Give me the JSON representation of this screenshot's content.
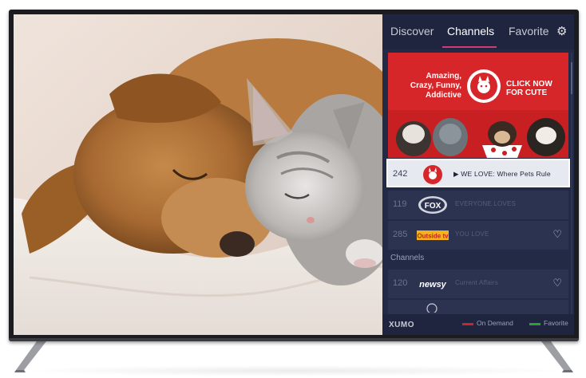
{
  "tabs": [
    {
      "label": "Discover"
    },
    {
      "label": "Channels"
    },
    {
      "label": "Favorite"
    }
  ],
  "icons": {
    "settings": "gear-icon",
    "heart": "heart-icon",
    "play": "play-icon"
  },
  "banner": {
    "tagline": "Amazing, Crazy, Funny, Addictive",
    "logo_text": "THE PET COLLECTIVE",
    "cta": "CLICK NOW FOR CUTE"
  },
  "channels_top": [
    {
      "number": "242",
      "logo": "THE PET COLLECTIVE",
      "title": "▶ WE LOVE: Where Pets Rule",
      "selected": true
    },
    {
      "number": "119",
      "logo": "FOX",
      "title": "EVERYONE LOVES",
      "selected": false
    },
    {
      "number": "285",
      "logo": "Outside tv",
      "title": "YOU LOVE",
      "selected": false
    }
  ],
  "section": {
    "label": "Channels"
  },
  "channels_bottom": [
    {
      "number": "120",
      "logo": "newsy",
      "title": "Current Affairs"
    }
  ],
  "footer": {
    "brand": "XUMO",
    "on_demand": "On Demand",
    "favorite": "Favorite"
  },
  "colors": {
    "panel": "#232a46",
    "accent": "#d13a78",
    "banner": "#d7262a",
    "on_demand": "#c62828",
    "favorite": "#2e9d3a"
  }
}
